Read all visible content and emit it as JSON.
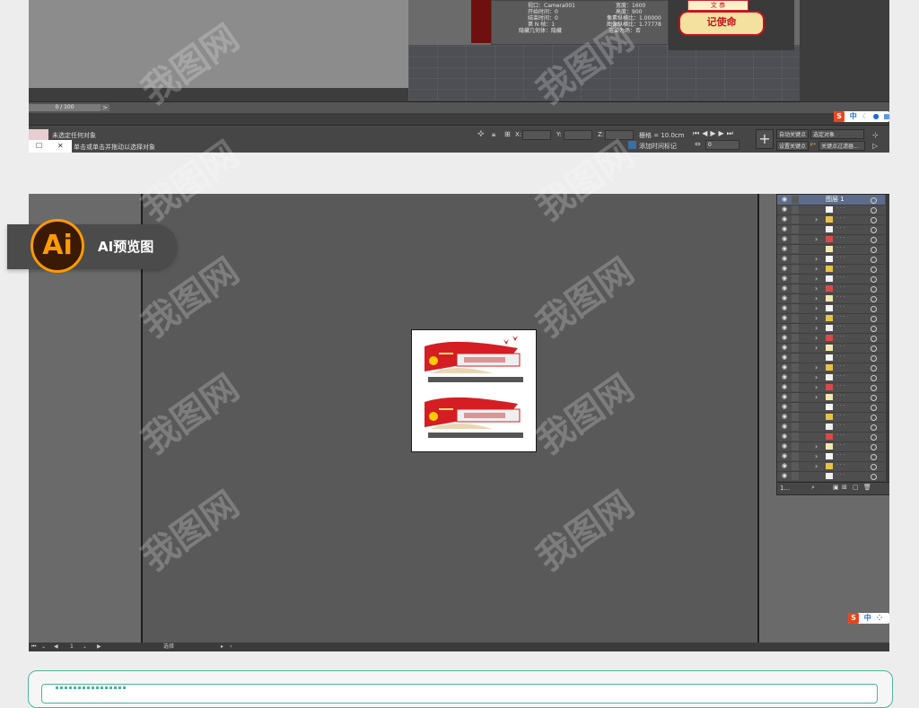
{
  "max_window": {
    "info": {
      "row0_left": "视口：Camera001",
      "row0_right": "宽度：1600",
      "start_time": "开始时间：0",
      "height": "高度：900",
      "end_time": "结束时间：0",
      "pixel_aspect": "像素纵横比：1.00000",
      "every_n_frames": "第 N 帧：1",
      "image_aspect": "图像纵横比：1.77778",
      "hide_geometry": "隐藏几何体：隐藏",
      "render_fields": "渲染为场：否"
    },
    "banner_top": "文 恭",
    "banner_text": "记使命",
    "timeline_value": "0 / 100",
    "timeline_arrow": ">",
    "status": {
      "no_selection": "未选定任何对象",
      "hint": "单击或单击并拖动以选择对象",
      "x_label": "X:",
      "y_label": "Y:",
      "z_label": "Z:",
      "grid": "栅格 = 10.0cm",
      "add_time_tag": "添加时间标记",
      "auto_key": "自动关键点",
      "set_key": "设置关键点",
      "selected_object": "选定对象",
      "key_filters": "关键点过滤器...",
      "frame_value": "0"
    },
    "ime": {
      "s_label": "S",
      "lang": "中"
    }
  },
  "ai_badge": {
    "logo": "Ai",
    "label": "AI预览图"
  },
  "illustrator": {
    "layers": {
      "top_layer_name": "图层 1",
      "footer_count": "1..."
    },
    "status_zoom": "1",
    "status_mode": "选择",
    "ime": {
      "s_label": "S",
      "lang": "中"
    }
  },
  "watermark": "我图网"
}
